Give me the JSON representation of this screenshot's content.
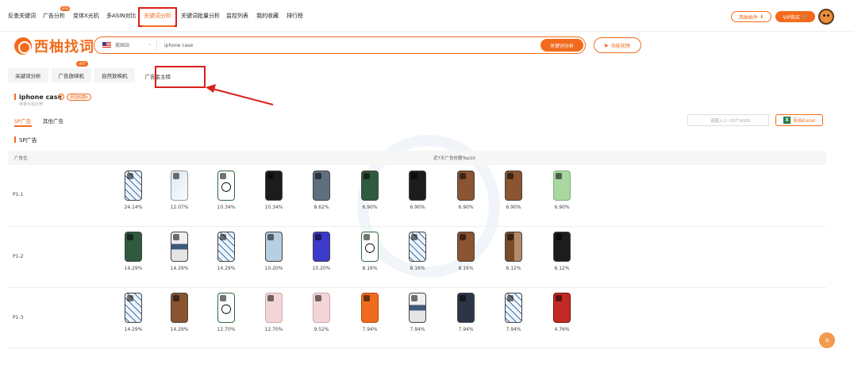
{
  "topnav": {
    "items": [
      "反查关键词",
      "广告分析",
      "变体X光机",
      "多ASIN对比",
      "关键词分析",
      "关键词批量分析",
      "监控列表",
      "我的收藏",
      "排行榜"
    ],
    "hot_badge": "NEW",
    "plugin_label": "西柚插件",
    "vip_label": "VIP购买"
  },
  "brand": {
    "name": "西柚找词"
  },
  "search": {
    "site": "美国站",
    "query": "iphone case",
    "button": "关键词分析",
    "video_label": "功能视频"
  },
  "tabs": {
    "items": [
      "关键词分析",
      "广告放映机",
      "自然放映机",
      "广告金主榜"
    ],
    "hot_badge": "HOT"
  },
  "keyword": {
    "title": "iphone case",
    "subtitle": "苹果手机外壳",
    "fav_label": "添加收藏"
  },
  "subtabs": {
    "sp": "SP广告",
    "other": "其他广告"
  },
  "asin_placeholder": "请输入1~10个ASIN",
  "export_label": "导出Excel",
  "section_title": "SP广告",
  "table": {
    "col_position": "广告位",
    "col_top": "近7天广告份额Top10",
    "rows": [
      {
        "label": "P1-1",
        "cells": [
          {
            "style": "doodle",
            "pct": "24.14%"
          },
          {
            "style": "clear",
            "pct": "12.07%"
          },
          {
            "style": "panda",
            "pct": "10.34%"
          },
          {
            "style": "black",
            "pct": "10.34%"
          },
          {
            "style": "grey",
            "pct": "8.62%"
          },
          {
            "style": "green",
            "pct": "6.90%"
          },
          {
            "style": "black",
            "pct": "6.90%"
          },
          {
            "style": "brown",
            "pct": "6.90%"
          },
          {
            "style": "brown",
            "pct": "6.90%"
          },
          {
            "style": "mint",
            "pct": "6.90%"
          }
        ]
      },
      {
        "label": "P1-2",
        "cells": [
          {
            "style": "green",
            "pct": "14.29%"
          },
          {
            "style": "photo",
            "pct": "14.29%"
          },
          {
            "style": "doodle",
            "pct": "14.29%"
          },
          {
            "style": "lightblue",
            "pct": "10.20%"
          },
          {
            "style": "blue",
            "pct": "10.20%"
          },
          {
            "style": "panda",
            "pct": "8.16%"
          },
          {
            "style": "doodle",
            "pct": "8.16%"
          },
          {
            "style": "brown",
            "pct": "8.16%"
          },
          {
            "style": "walnut",
            "pct": "6.12%"
          },
          {
            "style": "black",
            "pct": "6.12%"
          }
        ]
      },
      {
        "label": "P1-3",
        "cells": [
          {
            "style": "doodle",
            "pct": "14.29%"
          },
          {
            "style": "brown",
            "pct": "14.29%"
          },
          {
            "style": "panda",
            "pct": "12.70%"
          },
          {
            "style": "pink",
            "pct": "12.70%"
          },
          {
            "style": "pink",
            "pct": "9.52%"
          },
          {
            "style": "orange",
            "pct": "7.94%"
          },
          {
            "style": "photo",
            "pct": "7.94%"
          },
          {
            "style": "navy",
            "pct": "7.94%"
          },
          {
            "style": "doodle",
            "pct": "7.94%"
          },
          {
            "style": "red",
            "pct": "4.76%"
          }
        ]
      }
    ]
  },
  "colors": {
    "accent": "#f26b1d",
    "highlight": "#d9201b"
  }
}
